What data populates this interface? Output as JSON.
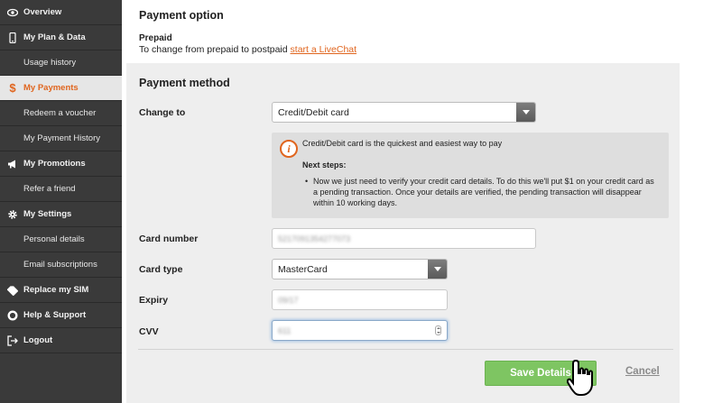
{
  "sidebar": {
    "items": [
      {
        "label": "Overview",
        "icon": "eye-icon"
      },
      {
        "label": "My Plan & Data",
        "icon": "phone-icon"
      },
      {
        "label": "Usage history"
      },
      {
        "label": "My Payments",
        "icon": "dollar-icon"
      },
      {
        "label": "Redeem a voucher"
      },
      {
        "label": "My Payment History"
      },
      {
        "label": "My Promotions",
        "icon": "megaphone-icon"
      },
      {
        "label": "Refer a friend"
      },
      {
        "label": "My Settings",
        "icon": "gear-icon"
      },
      {
        "label": "Personal details"
      },
      {
        "label": "Email subscriptions"
      },
      {
        "label": "Replace my SIM",
        "icon": "sim-icon"
      },
      {
        "label": "Help & Support",
        "icon": "lifebuoy-icon"
      },
      {
        "label": "Logout",
        "icon": "logout-icon"
      }
    ]
  },
  "payment_option": {
    "title": "Payment option",
    "plan_label": "Prepaid",
    "change_text": "To change from prepaid to postpaid",
    "livechat_link": "start a LiveChat"
  },
  "payment_method": {
    "title": "Payment method",
    "change_to_label": "Change to",
    "change_to_value": "Credit/Debit card",
    "info_title": "Credit/Debit card is the quickest and easiest way to pay",
    "next_steps_label": "Next steps:",
    "next_steps_text": "Now we just need to verify your credit card details. To do this we'll put $1 on your credit card as a pending transaction. Once your details are verified, the pending transaction will disappear within 10 working days.",
    "card_number_label": "Card number",
    "card_number_value": "5217091354277073",
    "card_type_label": "Card type",
    "card_type_value": "MasterCard",
    "expiry_label": "Expiry",
    "expiry_value": "09/17",
    "cvv_label": "CVV",
    "cvv_value": "611"
  },
  "actions": {
    "save_label": "Save Details",
    "cancel_label": "Cancel"
  },
  "colors": {
    "accent": "#e0651e",
    "save_button": "#7ec562",
    "sidebar_bg": "#3a3a3a"
  }
}
